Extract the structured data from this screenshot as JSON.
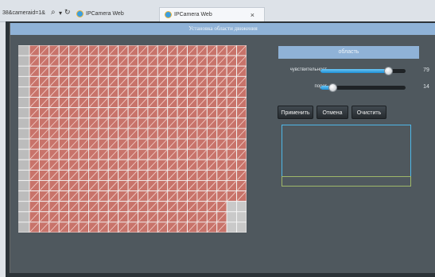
{
  "browser": {
    "address_fragment": "38&cameraid=1&",
    "search_glyph": "⌕",
    "dropdown_glyph": "▾",
    "refresh_glyph": "↻",
    "tabs": [
      {
        "label": "IPCamera Web",
        "active": false
      },
      {
        "label": "IPCamera Web",
        "active": true
      }
    ],
    "close_glyph": "×"
  },
  "window": {
    "title": "Установка области движения"
  },
  "grid": {
    "cols": 22,
    "rows": 18,
    "selected_color": "#c8736a",
    "unselected_color": "#c9c9c9",
    "unselected_cells": [
      [
        15,
        20
      ],
      [
        15,
        21
      ],
      [
        16,
        20
      ],
      [
        16,
        21
      ],
      [
        17,
        20
      ],
      [
        17,
        21
      ]
    ]
  },
  "right_panel": {
    "header": "область",
    "sensitivity": {
      "label": "чувствительност",
      "value": "79",
      "fraction": 0.79
    },
    "threshold": {
      "label": "порог",
      "value": "14",
      "fraction": 0.14
    },
    "buttons": {
      "apply": "Применить",
      "cancel": "Отмена",
      "clear": "Очистить"
    }
  },
  "colors": {
    "accent": "#8fb2d7",
    "panel": "#4f585e",
    "box_border": "#4fb7e8"
  }
}
